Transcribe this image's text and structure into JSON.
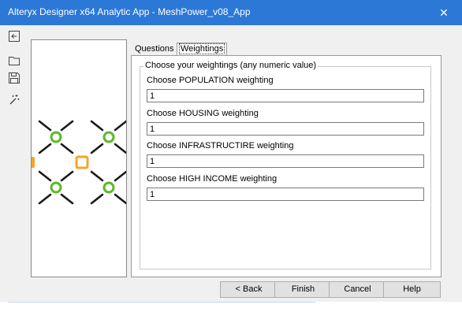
{
  "window": {
    "title": "Alteryx Designer x64 Analytic App - MeshPower_v08_App",
    "close_glyph": "✕",
    "accent_color": "#2b78d7"
  },
  "toolstrip": {
    "icons": [
      "back-to-design-icon",
      "open-folder-icon",
      "save-icon",
      "magic-wand-icon"
    ]
  },
  "canvas": {
    "node_colors": {
      "green": "#5cb82a",
      "orange": "#f5a623"
    },
    "connector_color": "#1a1a1a"
  },
  "tabs": [
    {
      "label": "Questions",
      "selected": false
    },
    {
      "label": "Weightings",
      "selected": true
    }
  ],
  "weightings": {
    "group_title": "Choose your weightings (any numeric value)",
    "fields": [
      {
        "label": "Choose POPULATION weighting",
        "value": "1"
      },
      {
        "label": "Choose HOUSING weighting",
        "value": "1"
      },
      {
        "label": "Choose INFRASTRUCTIRE weighting",
        "value": "1"
      },
      {
        "label": "Choose HIGH INCOME weighting",
        "value": "1"
      }
    ]
  },
  "buttons": {
    "back": "< Back",
    "finish": "Finish",
    "cancel": "Cancel",
    "help": "Help"
  }
}
